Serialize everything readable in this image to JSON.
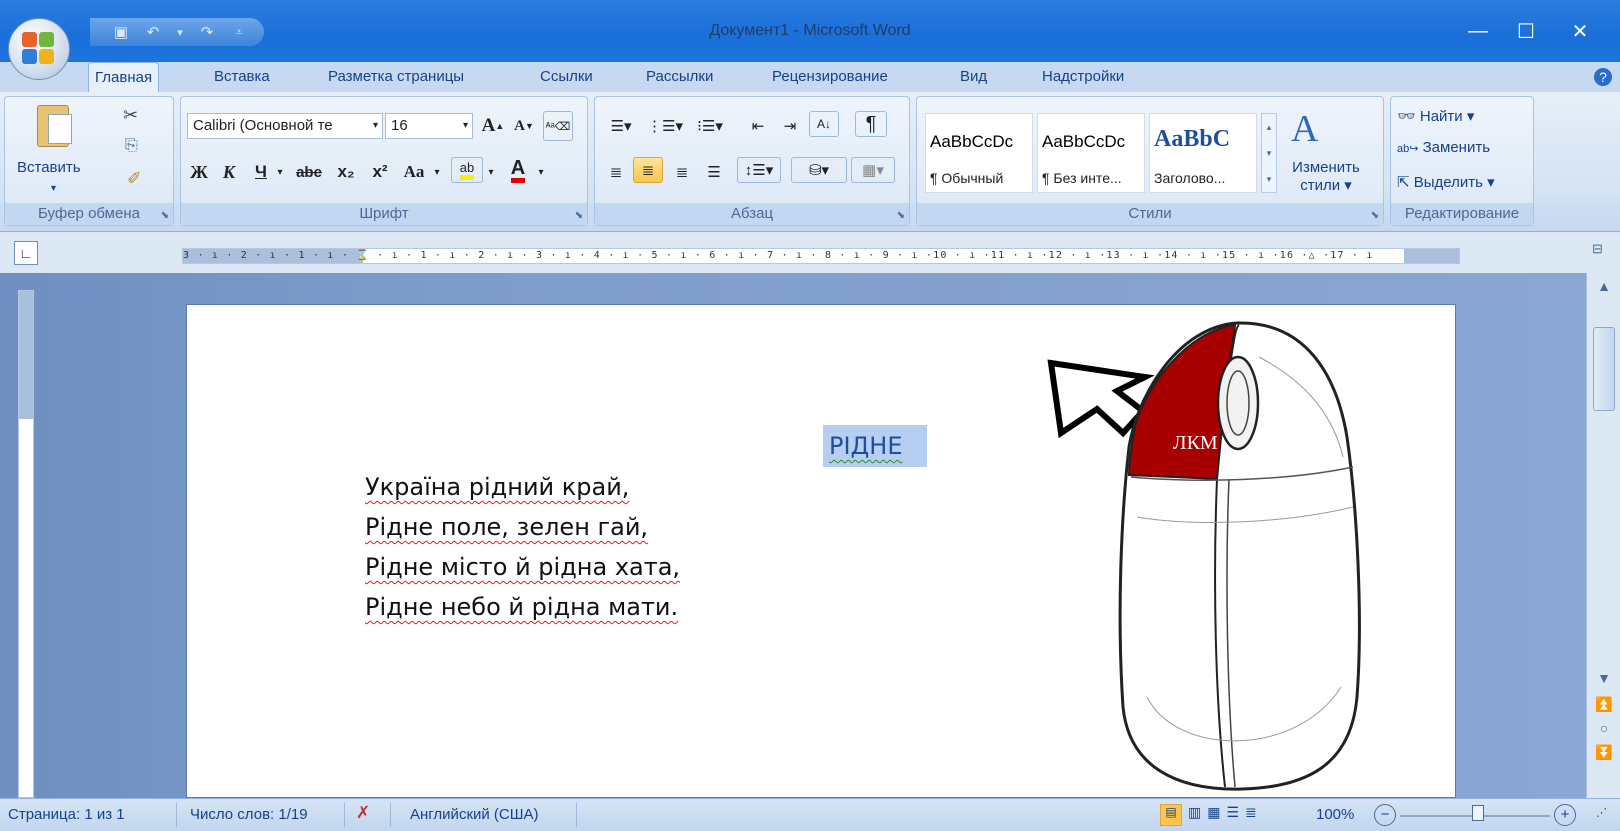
{
  "window": {
    "title": "Документ1 - Microsoft Word"
  },
  "tabs": [
    "Главная",
    "Вставка",
    "Разметка страницы",
    "Ссылки",
    "Рассылки",
    "Рецензирование",
    "Вид",
    "Надстройки"
  ],
  "clipboard": {
    "paste_label": "Вставить",
    "group_label": "Буфер обмена"
  },
  "font": {
    "name": "Calibri (Основной те",
    "size": "16",
    "group_label": "Шрифт",
    "bold": "Ж",
    "italic": "К",
    "underline": "Ч",
    "strike": "abe",
    "subscript": "x₂",
    "superscript": "x²",
    "case": "Aa",
    "grow": "A",
    "shrink": "A"
  },
  "paragraph": {
    "group_label": "Абзац",
    "pilcrow": "¶"
  },
  "styles": {
    "group_label": "Стили",
    "items": [
      {
        "preview": "AaBbCcDc",
        "name": "¶ Обычный"
      },
      {
        "preview": "AaBbCcDc",
        "name": "¶ Без инте..."
      },
      {
        "preview": "AaBbC",
        "name": "Заголово..."
      }
    ],
    "change_label_1": "Изменить",
    "change_label_2": "стили"
  },
  "editing": {
    "find": "Найти",
    "replace": "Заменить",
    "select": "Выделить",
    "group_label": "Редактирование"
  },
  "ruler": {
    "tick_text": "3 · ı · 2 · ı · 1 · ı · ⌛ · ı · 1 · ı · 2 · ı · 3 · ı · 4 · ı · 5 · ı · 6 · ı · 7 · ı · 8 · ı · 9 · ı ·10 · ı ·11 · ı ·12 · ı ·13 · ı ·14 · ı ·15 · ı ·16 ·△ ·17 · ı"
  },
  "document": {
    "heading": "РІДНЕ",
    "lines": [
      "Україна рідний край,",
      "Рідне поле, зелен гай,",
      "Рідне місто й рідна хата,",
      "Рідне небо й рідна мати."
    ]
  },
  "mouse_illustration": {
    "left_button_label": "ЛКМ",
    "left_button_color": "#a80000"
  },
  "status": {
    "page": "Страница: 1 из 1",
    "words": "Число слов: 1/19",
    "language": "Английский (США)",
    "zoom": "100%"
  },
  "colors": {
    "titlebar": "#1a6fd9",
    "ribbon": "#dce8f6",
    "doc_background": "#7f9dcb",
    "selection": "#b6cff0"
  }
}
